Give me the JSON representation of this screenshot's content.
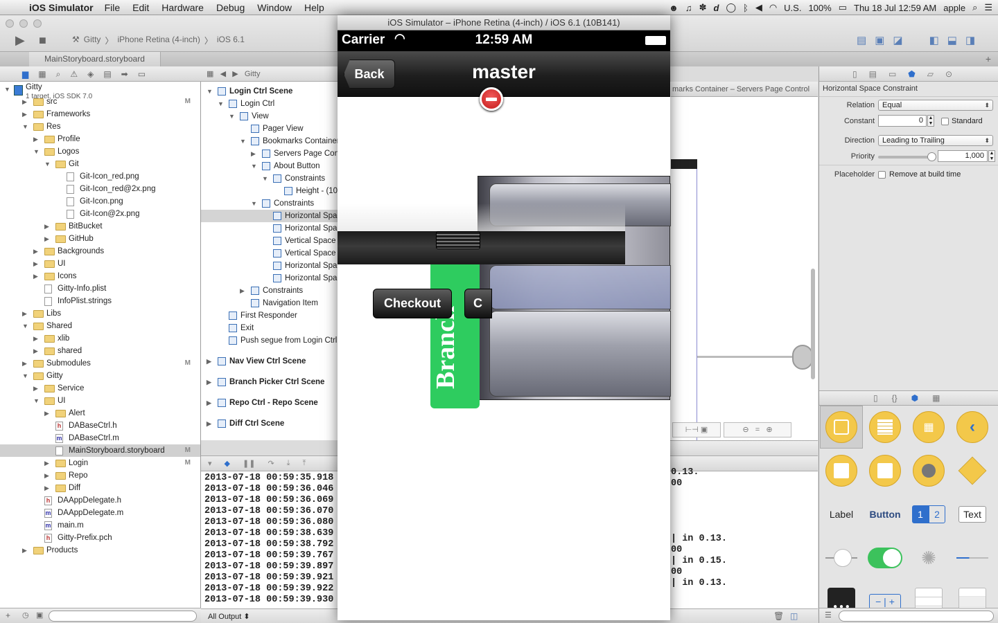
{
  "menubar": {
    "app": "iOS Simulator",
    "items": [
      "File",
      "Edit",
      "Hardware",
      "Debug",
      "Window",
      "Help"
    ],
    "input_source": "U.S.",
    "battery": "100%",
    "clock": "Thu 18 Jul  12:59 AM",
    "user": "apple"
  },
  "xcode": {
    "scheme": "Gitty",
    "destination": "iPhone Retina (4-inch)",
    "sdk": "iOS 6.1",
    "tab": "MainStoryboard.storyboard",
    "jump_bar": [
      "Gitty"
    ],
    "canvas_breadcrumb": "marks Container – Servers Page Control",
    "output_filter": "All Output ⬍"
  },
  "navigator": {
    "project": "Gitty",
    "project_sub": "1 target, iOS SDK 7.0",
    "rows": [
      {
        "label": "src",
        "depth": 1,
        "kind": "folder",
        "open": false,
        "badge": "M"
      },
      {
        "label": "Frameworks",
        "depth": 1,
        "kind": "folder",
        "open": false,
        "badge": ""
      },
      {
        "label": "Res",
        "depth": 1,
        "kind": "folder",
        "open": true,
        "badge": ""
      },
      {
        "label": "Profile",
        "depth": 2,
        "kind": "folder",
        "open": false,
        "badge": ""
      },
      {
        "label": "Logos",
        "depth": 2,
        "kind": "folder",
        "open": true,
        "badge": ""
      },
      {
        "label": "Git",
        "depth": 3,
        "kind": "folder",
        "open": true,
        "badge": ""
      },
      {
        "label": "Git-Icon_red.png",
        "depth": 4,
        "kind": "file",
        "open": null,
        "badge": ""
      },
      {
        "label": "Git-Icon_red@2x.png",
        "depth": 4,
        "kind": "file",
        "open": null,
        "badge": ""
      },
      {
        "label": "Git-Icon.png",
        "depth": 4,
        "kind": "file",
        "open": null,
        "badge": ""
      },
      {
        "label": "Git-Icon@2x.png",
        "depth": 4,
        "kind": "file",
        "open": null,
        "badge": ""
      },
      {
        "label": "BitBucket",
        "depth": 3,
        "kind": "folder",
        "open": false,
        "badge": ""
      },
      {
        "label": "GitHub",
        "depth": 3,
        "kind": "folder",
        "open": false,
        "badge": ""
      },
      {
        "label": "Backgrounds",
        "depth": 2,
        "kind": "folder",
        "open": false,
        "badge": ""
      },
      {
        "label": "UI",
        "depth": 2,
        "kind": "folder",
        "open": false,
        "badge": ""
      },
      {
        "label": "Icons",
        "depth": 2,
        "kind": "folder",
        "open": false,
        "badge": ""
      },
      {
        "label": "Gitty-Info.plist",
        "depth": 2,
        "kind": "file",
        "open": null,
        "badge": ""
      },
      {
        "label": "InfoPlist.strings",
        "depth": 2,
        "kind": "file",
        "open": null,
        "badge": ""
      },
      {
        "label": "Libs",
        "depth": 1,
        "kind": "folder",
        "open": false,
        "badge": ""
      },
      {
        "label": "Shared",
        "depth": 1,
        "kind": "folder",
        "open": true,
        "badge": ""
      },
      {
        "label": "xlib",
        "depth": 2,
        "kind": "folder",
        "open": false,
        "badge": ""
      },
      {
        "label": "shared",
        "depth": 2,
        "kind": "folder",
        "open": false,
        "badge": ""
      },
      {
        "label": "Submodules",
        "depth": 1,
        "kind": "folder",
        "open": false,
        "badge": "M"
      },
      {
        "label": "Gitty",
        "depth": 1,
        "kind": "folder",
        "open": true,
        "badge": ""
      },
      {
        "label": "Service",
        "depth": 2,
        "kind": "folder",
        "open": false,
        "badge": ""
      },
      {
        "label": "UI",
        "depth": 2,
        "kind": "folder",
        "open": true,
        "badge": ""
      },
      {
        "label": "Alert",
        "depth": 3,
        "kind": "folder",
        "open": false,
        "badge": ""
      },
      {
        "label": "DABaseCtrl.h",
        "depth": 3,
        "kind": "h",
        "open": null,
        "badge": ""
      },
      {
        "label": "DABaseCtrl.m",
        "depth": 3,
        "kind": "m",
        "open": null,
        "badge": ""
      },
      {
        "label": "MainStoryboard.storyboard",
        "depth": 3,
        "kind": "file",
        "open": null,
        "badge": "M",
        "selected": true
      },
      {
        "label": "Login",
        "depth": 3,
        "kind": "folder",
        "open": false,
        "badge": "M"
      },
      {
        "label": "Repo",
        "depth": 3,
        "kind": "folder",
        "open": false,
        "badge": ""
      },
      {
        "label": "Diff",
        "depth": 3,
        "kind": "folder",
        "open": false,
        "badge": ""
      },
      {
        "label": "DAAppDelegate.h",
        "depth": 2,
        "kind": "h",
        "open": null,
        "badge": ""
      },
      {
        "label": "DAAppDelegate.m",
        "depth": 2,
        "kind": "m",
        "open": null,
        "badge": ""
      },
      {
        "label": "main.m",
        "depth": 2,
        "kind": "m",
        "open": null,
        "badge": ""
      },
      {
        "label": "Gitty-Prefix.pch",
        "depth": 2,
        "kind": "h",
        "open": null,
        "badge": ""
      },
      {
        "label": "Products",
        "depth": 1,
        "kind": "folder",
        "open": false,
        "badge": ""
      }
    ]
  },
  "outline": {
    "rows": [
      {
        "label": "Login Ctrl Scene",
        "depth": 0,
        "scene": true,
        "open": true
      },
      {
        "label": "Login Ctrl",
        "depth": 1,
        "open": true
      },
      {
        "label": "View",
        "depth": 2,
        "open": true
      },
      {
        "label": "Pager View",
        "depth": 3,
        "open": null
      },
      {
        "label": "Bookmarks Container",
        "depth": 3,
        "open": true
      },
      {
        "label": "Servers Page Control",
        "depth": 4,
        "open": false
      },
      {
        "label": "About Button",
        "depth": 4,
        "open": true
      },
      {
        "label": "Constraints",
        "depth": 5,
        "open": true
      },
      {
        "label": "Height - (10",
        "depth": 6,
        "open": null
      },
      {
        "label": "Constraints",
        "depth": 4,
        "open": true
      },
      {
        "label": "Horizontal Space",
        "depth": 5,
        "open": null,
        "selected": true
      },
      {
        "label": "Horizontal Space",
        "depth": 5,
        "open": null
      },
      {
        "label": "Vertical Space",
        "depth": 5,
        "open": null
      },
      {
        "label": "Vertical Space -",
        "depth": 5,
        "open": null
      },
      {
        "label": "Horizontal Space",
        "depth": 5,
        "open": null
      },
      {
        "label": "Horizontal Space",
        "depth": 5,
        "open": null
      },
      {
        "label": "Constraints",
        "depth": 3,
        "open": false
      },
      {
        "label": "Navigation Item",
        "depth": 3,
        "open": null
      },
      {
        "label": "First Responder",
        "depth": 1,
        "open": null
      },
      {
        "label": "Exit",
        "depth": 1,
        "open": null
      },
      {
        "label": "Push segue from Login Ctrl",
        "depth": 1,
        "open": null
      },
      {
        "label": "Nav View Ctrl Scene",
        "depth": 0,
        "scene": true,
        "open": false
      },
      {
        "label": "Branch Picker Ctrl Scene",
        "depth": 0,
        "scene": true,
        "open": false
      },
      {
        "label": "Repo Ctrl - Repo Scene",
        "depth": 0,
        "scene": true,
        "open": false
      },
      {
        "label": "Diff Ctrl Scene",
        "depth": 0,
        "scene": true,
        "open": false
      }
    ]
  },
  "console": {
    "lines": [
      "2013-07-18 00:59:35.918",
      "2013-07-18 00:59:36.046",
      "2013-07-18 00:59:36.069",
      "2013-07-18 00:59:36.070",
      "2013-07-18 00:59:36.080",
      "2013-07-18 00:59:38.639",
      "2013-07-18 00:59:38.792",
      "2013-07-18 00:59:39.767",
      "2013-07-18 00:59:39.897",
      "2013-07-18 00:59:39.921",
      "2013-07-18 00:59:39.922",
      "2013-07-18 00:59:39.930"
    ],
    "tails": [
      "0.13.",
      "00",
      "| in 0.13.",
      "00",
      "| in 0.15.",
      "00",
      "| in 0.13."
    ]
  },
  "inspector": {
    "title": "Horizontal Space Constraint",
    "relation_label": "Relation",
    "relation": "Equal",
    "constant_label": "Constant",
    "constant": "0",
    "standard_label": "Standard",
    "direction_label": "Direction",
    "direction": "Leading to Trailing",
    "priority_label": "Priority",
    "priority": "1,000",
    "priority_level": 1.0,
    "placeholder_label": "Placeholder",
    "placeholder_text": "Remove at build time"
  },
  "library": {
    "labels": {
      "label": "Label",
      "button": "Button",
      "segment_1": "1",
      "segment_2": "2",
      "text": "Text"
    }
  },
  "simulator": {
    "window_title": "iOS Simulator – iPhone Retina (4-inch) / iOS 6.1 (10B141)",
    "carrier": "Carrier",
    "time": "12:59 AM",
    "nav_title": "master",
    "back_label": "Back",
    "branch_label": "Branch",
    "checkout_label": "Checkout",
    "second_button_label": "C",
    "accent_green": "#2ecc5f",
    "delete_red": "#d42424"
  }
}
